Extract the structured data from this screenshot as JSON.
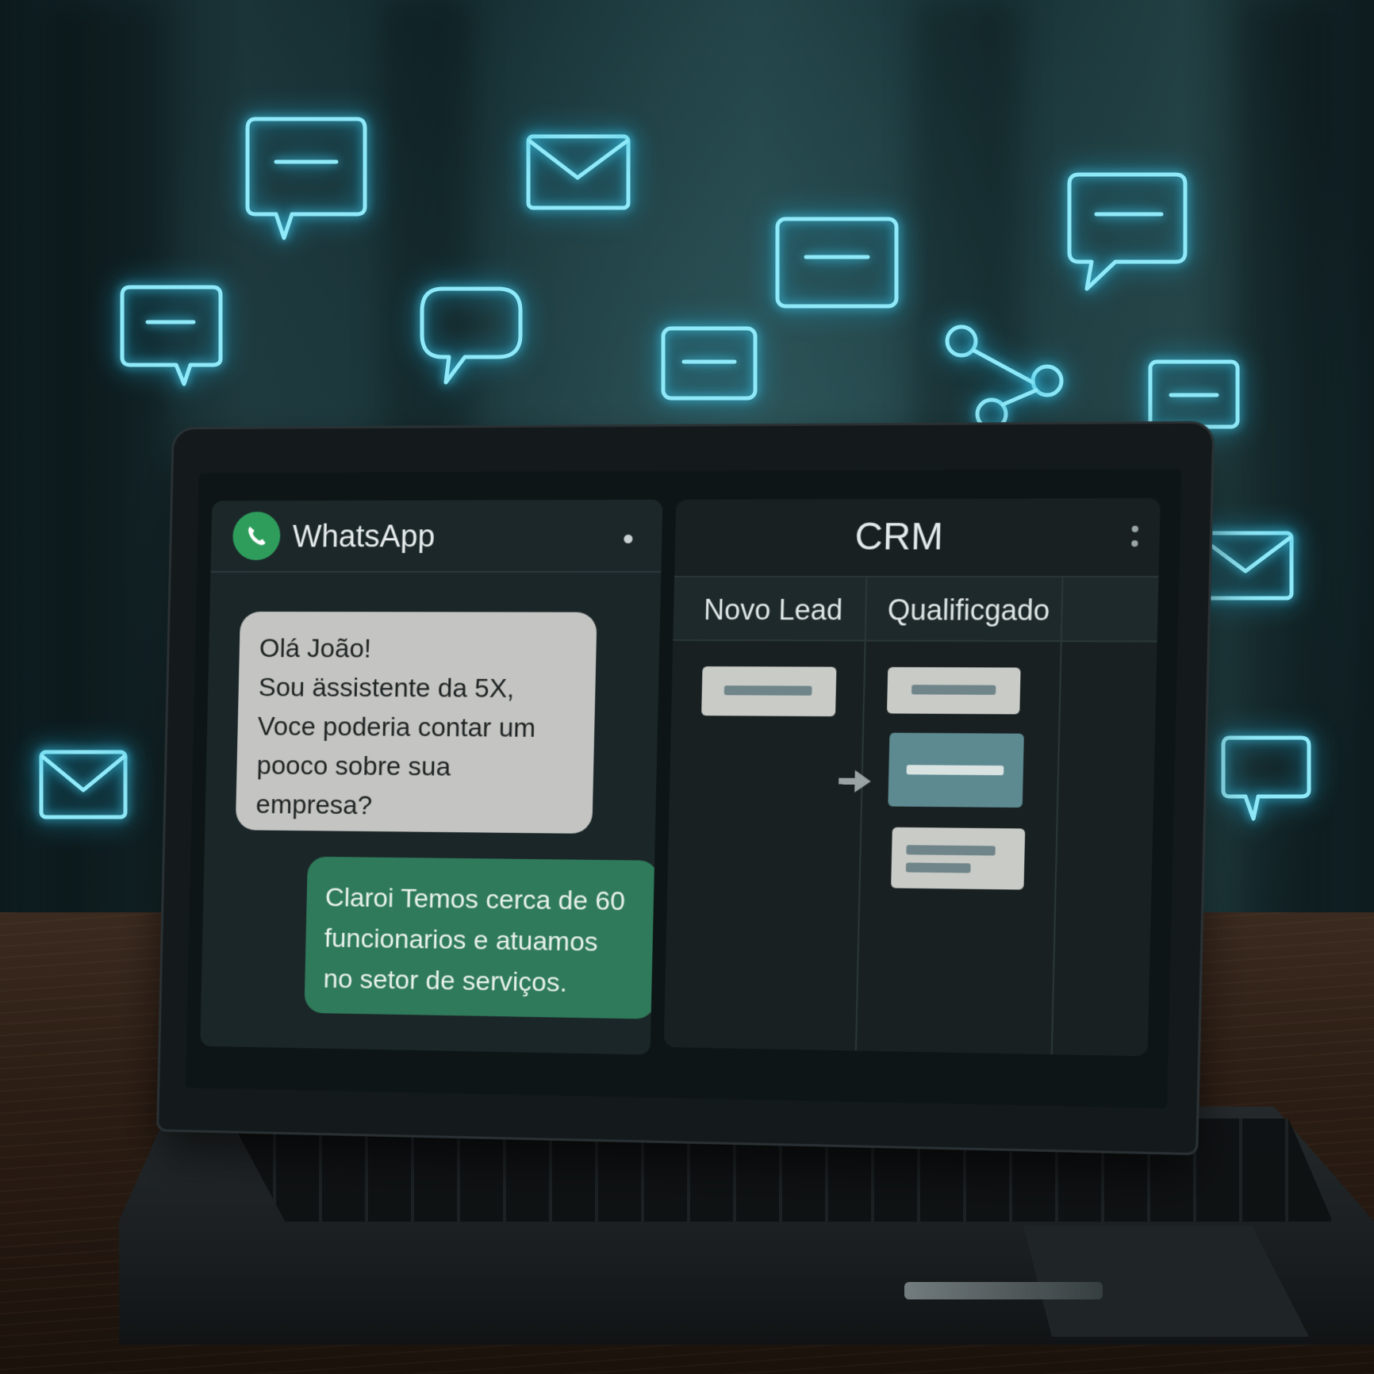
{
  "scene": {
    "accent_neon": "#8fe9f8",
    "floating_icons": [
      {
        "name": "chat-bubble-icon"
      },
      {
        "name": "envelope-icon"
      },
      {
        "name": "message-card-icon"
      },
      {
        "name": "share-icon"
      }
    ]
  },
  "whatsapp": {
    "title": "WhatsApp",
    "brand_color": "#2e9d5c",
    "incoming_message": {
      "lines": [
        "Olá João!",
        "Sou ässistente da 5X,",
        "Voce poderia contar um",
        "pooco sobre sua",
        "empresa?"
      ]
    },
    "outgoing_message": {
      "lines": [
        "Claroi Temos cerca de 60",
        "funcionarios e atuamos",
        "no setor de serviços."
      ]
    }
  },
  "crm": {
    "title": "CRM",
    "columns": [
      {
        "label": "Novo Lead"
      },
      {
        "label": "Qualificgado"
      }
    ]
  }
}
